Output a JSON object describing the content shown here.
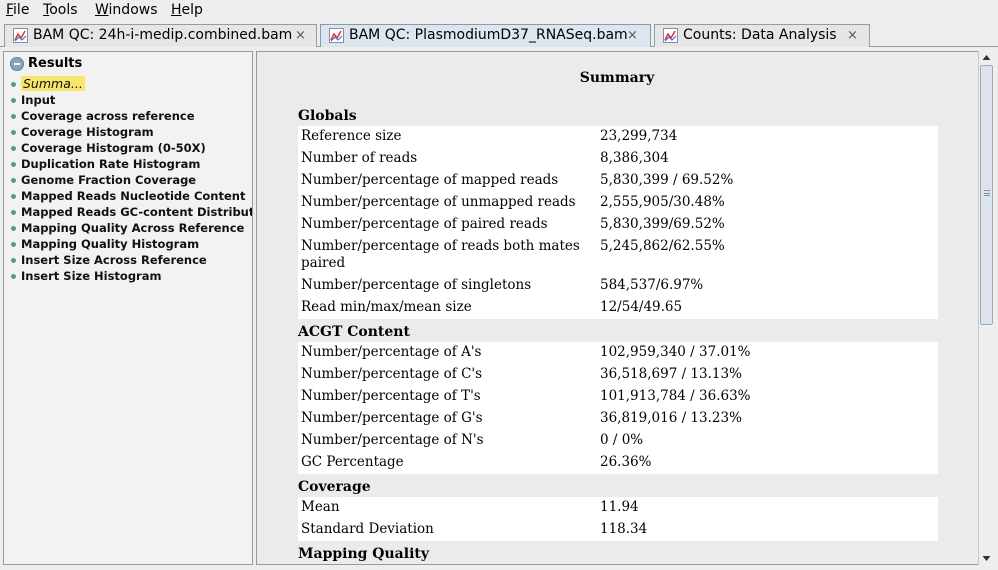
{
  "menubar": {
    "items": [
      {
        "first": "F",
        "rest": "ile"
      },
      {
        "first": "T",
        "rest": "ools"
      },
      {
        "first": "W",
        "rest": "indows"
      },
      {
        "first": "H",
        "rest": "elp"
      }
    ]
  },
  "tabs": [
    {
      "label": "BAM QC: 24h-i-medip.combined.bam",
      "close": "×"
    },
    {
      "label": "BAM QC: PlasmodiumD37_RNASeq.bam",
      "close": "×"
    },
    {
      "label": "Counts: Data Analysis",
      "close": "×"
    }
  ],
  "sidebar": {
    "root_label": "Results",
    "items": [
      "Summa...",
      "Input",
      "Coverage across reference",
      "Coverage Histogram",
      "Coverage Histogram (0-50X)",
      "Duplication Rate Histogram",
      "Genome Fraction Coverage",
      "Mapped Reads Nucleotide Content",
      "Mapped Reads GC-content Distributi",
      "Mapping Quality Across Reference",
      "Mapping Quality Histogram",
      "Insert Size Across Reference",
      "Insert Size Histogram"
    ]
  },
  "report": {
    "title": "Summary",
    "sections": [
      {
        "heading": "Globals",
        "rows": [
          {
            "k": "Reference size",
            "v": "23,299,734"
          },
          {
            "k": "Number of reads",
            "v": "8,386,304"
          },
          {
            "k": "Number/percentage of mapped reads",
            "v": "5,830,399 / 69.52%"
          },
          {
            "k": "Number/percentage of unmapped reads",
            "v": "2,555,905/30.48%"
          },
          {
            "k": "Number/percentage of paired reads",
            "v": "5,830,399/69.52%"
          },
          {
            "k": "Number/percentage of reads both mates paired",
            "v": "5,245,862/62.55%"
          },
          {
            "k": "Number/percentage of singletons",
            "v": "584,537/6.97%"
          },
          {
            "k": "Read min/max/mean size",
            "v": "12/54/49.65"
          }
        ]
      },
      {
        "heading": "ACGT Content",
        "rows": [
          {
            "k": "Number/percentage of A's",
            "v": "102,959,340 / 37.01%"
          },
          {
            "k": "Number/percentage of C's",
            "v": "36,518,697 / 13.13%"
          },
          {
            "k": "Number/percentage of T's",
            "v": "101,913,784 / 36.63%"
          },
          {
            "k": "Number/percentage of G's",
            "v": "36,819,016 / 13.23%"
          },
          {
            "k": "Number/percentage of N's",
            "v": "0 / 0%"
          },
          {
            "k": "GC Percentage",
            "v": "26.36%"
          }
        ]
      },
      {
        "heading": "Coverage",
        "rows": [
          {
            "k": "Mean",
            "v": "11.94"
          },
          {
            "k": "Standard Deviation",
            "v": "118.34"
          }
        ]
      },
      {
        "heading": "Mapping Quality",
        "rows": []
      }
    ]
  },
  "colors": {
    "selected_highlight": "#f8e66c",
    "tree_bullet": "#4aa27a",
    "active_tab": "#dde6ef"
  }
}
